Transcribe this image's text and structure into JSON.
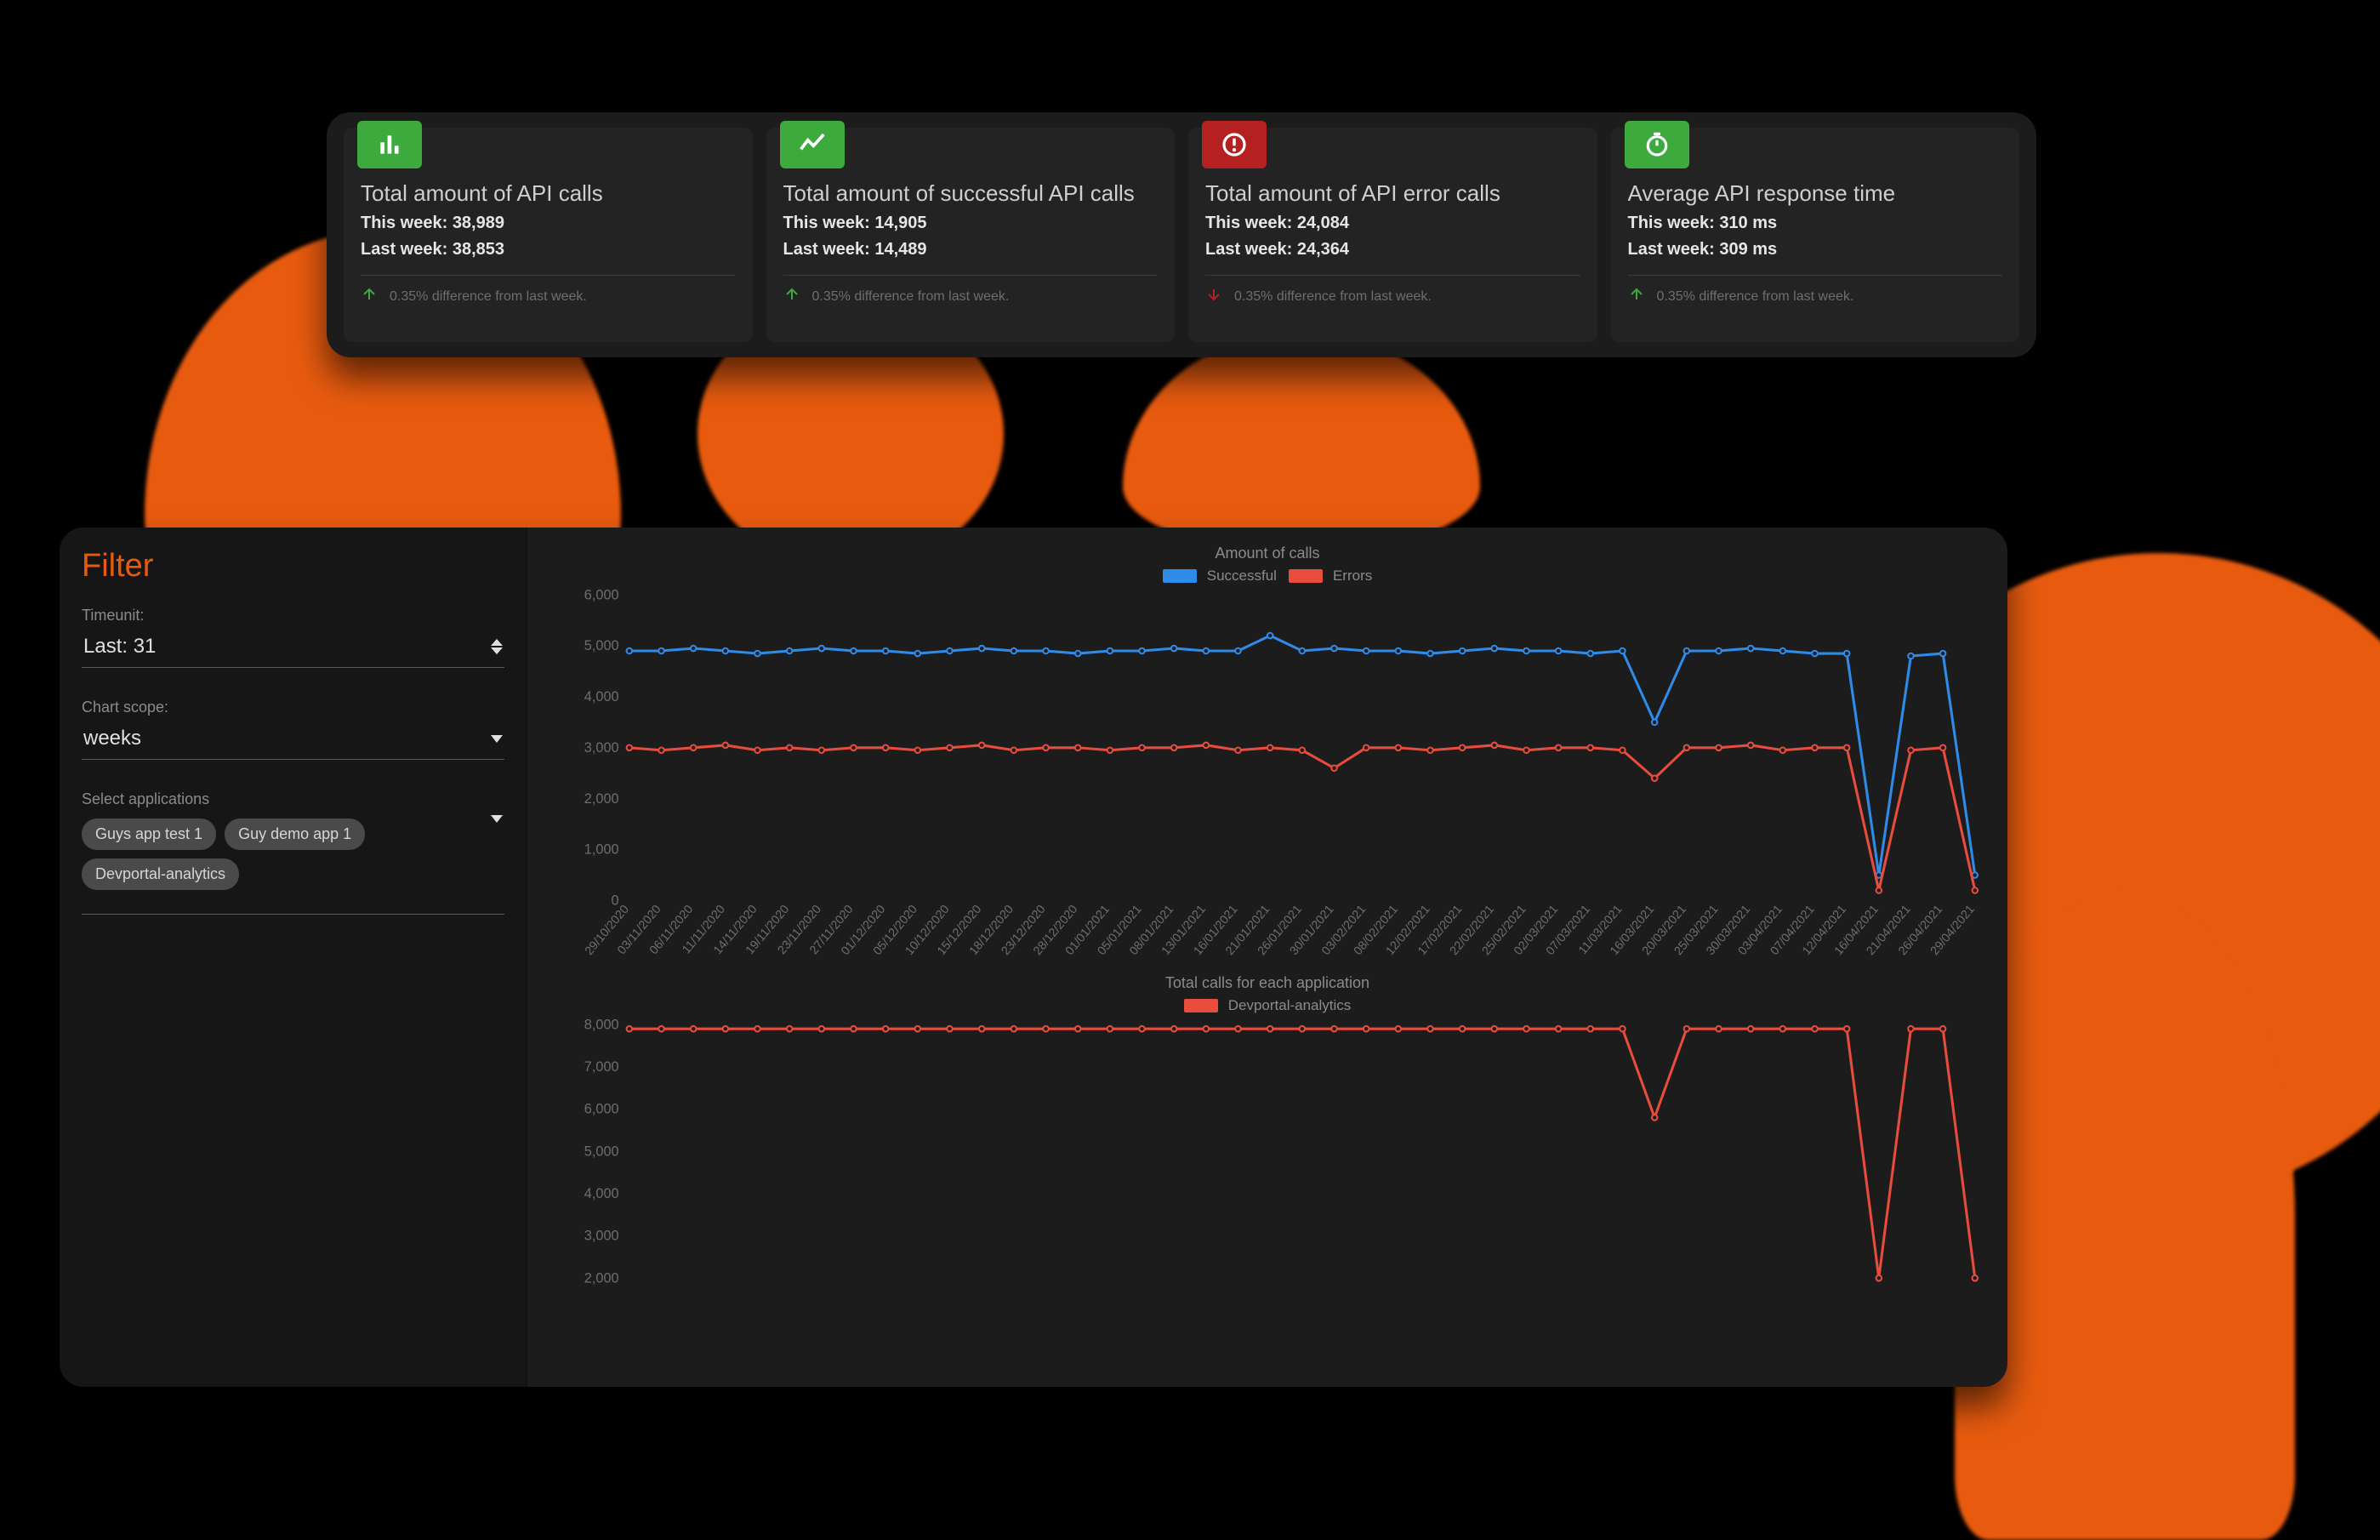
{
  "colors": {
    "accent": "#e85b0f",
    "green": "#3caa3c",
    "red": "#b52121",
    "series_red": "#e74c3c",
    "series_blue": "#2f8be8"
  },
  "stats": [
    {
      "icon": "bar-chart-icon",
      "icon_color": "green",
      "title": "Total amount of API calls",
      "this_week": "This week: 38,989",
      "last_week": "Last week: 38,853",
      "diff_dir": "up",
      "diff_text": "0.35% difference from last week."
    },
    {
      "icon": "trend-icon",
      "icon_color": "green",
      "title": "Total amount of successful API calls",
      "this_week": "This week: 14,905",
      "last_week": "Last week: 14,489",
      "diff_dir": "up",
      "diff_text": "0.35% difference from last week."
    },
    {
      "icon": "alert-icon",
      "icon_color": "red",
      "title": "Total amount of API error calls",
      "this_week": "This week: 24,084",
      "last_week": "Last week: 24,364",
      "diff_dir": "down",
      "diff_text": "0.35% difference from last week."
    },
    {
      "icon": "timer-icon",
      "icon_color": "green",
      "title": "Average API response time",
      "this_week": "This week: 310 ms",
      "last_week": "Last week: 309 ms",
      "diff_dir": "up",
      "diff_text": "0.35% difference from last week."
    }
  ],
  "filter": {
    "heading": "Filter",
    "timeunit_label": "Timeunit:",
    "timeunit_value": "Last: 31",
    "scope_label": "Chart scope:",
    "scope_value": "weeks",
    "apps_label": "Select applications",
    "apps": [
      "Guys app test 1",
      "Guy demo app 1",
      "Devportal-analytics"
    ]
  },
  "chart_data": [
    {
      "type": "line",
      "title": "Amount of calls",
      "legend": [
        "Successful",
        "Errors"
      ],
      "xlabel": "",
      "ylabel": "",
      "ylim": [
        0,
        6000
      ],
      "yticks": [
        0,
        1000,
        2000,
        3000,
        4000,
        5000,
        6000
      ],
      "categories": [
        "29/10/2020",
        "03/11/2020",
        "06/11/2020",
        "11/11/2020",
        "14/11/2020",
        "19/11/2020",
        "23/11/2020",
        "27/11/2020",
        "01/12/2020",
        "05/12/2020",
        "10/12/2020",
        "15/12/2020",
        "18/12/2020",
        "23/12/2020",
        "28/12/2020",
        "01/01/2021",
        "05/01/2021",
        "08/01/2021",
        "13/01/2021",
        "16/01/2021",
        "21/01/2021",
        "26/01/2021",
        "30/01/2021",
        "03/02/2021",
        "08/02/2021",
        "12/02/2021",
        "17/02/2021",
        "22/02/2021",
        "25/02/2021",
        "02/03/2021",
        "07/03/2021",
        "11/03/2021",
        "16/03/2021",
        "20/03/2021",
        "25/03/2021",
        "30/03/2021",
        "03/04/2021",
        "07/04/2021",
        "12/04/2021",
        "16/04/2021",
        "21/04/2021",
        "26/04/2021",
        "29/04/2021"
      ],
      "series": [
        {
          "name": "Errors",
          "color": "#2f8be8",
          "values": [
            4900,
            4900,
            4950,
            4900,
            4850,
            4900,
            4950,
            4900,
            4900,
            4850,
            4900,
            4950,
            4900,
            4900,
            4850,
            4900,
            4900,
            4950,
            4900,
            4900,
            5200,
            4900,
            4950,
            4900,
            4900,
            4850,
            4900,
            4950,
            4900,
            4900,
            4850,
            4900,
            3500,
            4900,
            4900,
            4950,
            4900,
            4850,
            4850,
            500,
            4800,
            4850,
            500
          ]
        },
        {
          "name": "Successful",
          "color": "#e74c3c",
          "values": [
            3000,
            2950,
            3000,
            3050,
            2950,
            3000,
            2950,
            3000,
            3000,
            2950,
            3000,
            3050,
            2950,
            3000,
            3000,
            2950,
            3000,
            3000,
            3050,
            2950,
            3000,
            2950,
            2600,
            3000,
            3000,
            2950,
            3000,
            3050,
            2950,
            3000,
            3000,
            2950,
            2400,
            3000,
            3000,
            3050,
            2950,
            3000,
            3000,
            200,
            2950,
            3000,
            200
          ]
        }
      ]
    },
    {
      "type": "line",
      "title": "Total calls for each application",
      "legend": [
        "Devportal-analytics"
      ],
      "xlabel": "",
      "ylabel": "",
      "ylim": [
        2000,
        8000
      ],
      "yticks": [
        2000,
        3000,
        4000,
        5000,
        6000,
        7000,
        8000
      ],
      "categories": [
        "29/10/2020",
        "03/11/2020",
        "06/11/2020",
        "11/11/2020",
        "14/11/2020",
        "19/11/2020",
        "23/11/2020",
        "27/11/2020",
        "01/12/2020",
        "05/12/2020",
        "10/12/2020",
        "15/12/2020",
        "18/12/2020",
        "23/12/2020",
        "28/12/2020",
        "01/01/2021",
        "05/01/2021",
        "08/01/2021",
        "13/01/2021",
        "16/01/2021",
        "21/01/2021",
        "26/01/2021",
        "30/01/2021",
        "03/02/2021",
        "08/02/2021",
        "12/02/2021",
        "17/02/2021",
        "22/02/2021",
        "25/02/2021",
        "02/03/2021",
        "07/03/2021",
        "11/03/2021",
        "16/03/2021",
        "20/03/2021",
        "25/03/2021",
        "30/03/2021",
        "03/04/2021",
        "07/04/2021",
        "12/04/2021",
        "16/04/2021",
        "21/04/2021",
        "26/04/2021",
        "29/04/2021"
      ],
      "series": [
        {
          "name": "Devportal-analytics",
          "color": "#e74c3c",
          "values": [
            7900,
            7900,
            7900,
            7900,
            7900,
            7900,
            7900,
            7900,
            7900,
            7900,
            7900,
            7900,
            7900,
            7900,
            7900,
            7900,
            7900,
            7900,
            7900,
            7900,
            7900,
            7900,
            7900,
            7900,
            7900,
            7900,
            7900,
            7900,
            7900,
            7900,
            7900,
            7900,
            5800,
            7900,
            7900,
            7900,
            7900,
            7900,
            7900,
            2000,
            7900,
            7900,
            2000
          ]
        }
      ]
    }
  ]
}
